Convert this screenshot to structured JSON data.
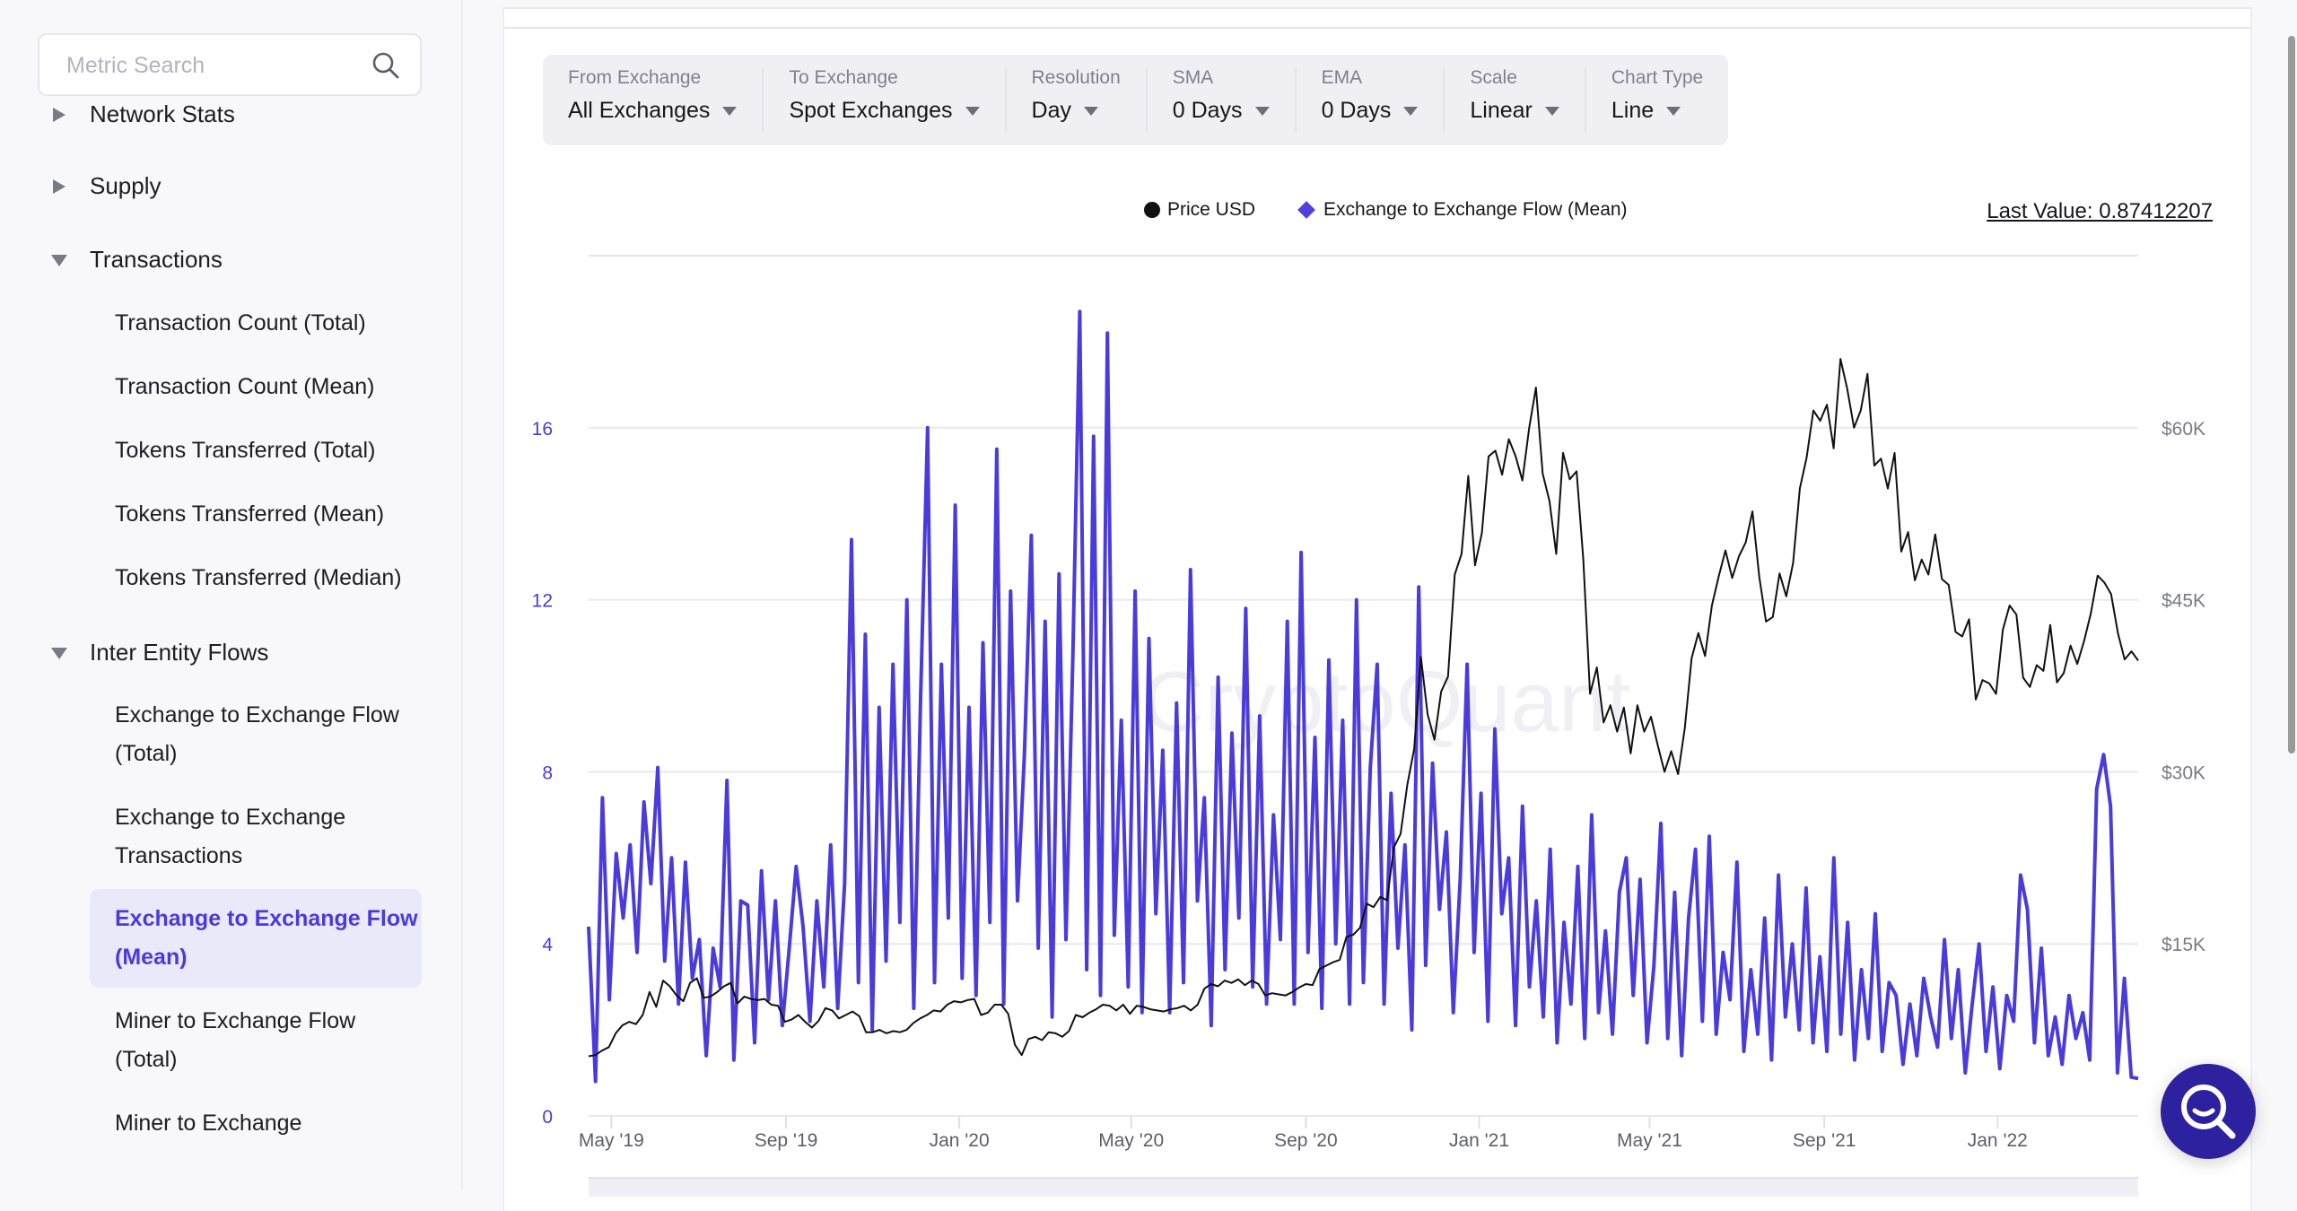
{
  "sidebar": {
    "search_placeholder": "Metric Search",
    "groups": [
      {
        "label": "Network Stats",
        "expanded": false
      },
      {
        "label": "Supply",
        "expanded": false
      },
      {
        "label": "Transactions",
        "expanded": true
      },
      {
        "label": "Inter Entity Flows",
        "expanded": true
      }
    ],
    "transactions_items": [
      "Transaction Count (Total)",
      "Transaction Count (Mean)",
      "Tokens Transferred (Total)",
      "Tokens Transferred (Mean)",
      "Tokens Transferred (Median)"
    ],
    "flows_items": [
      {
        "line1": "Exchange to Exchange Flow",
        "line2": "(Total)",
        "active": false
      },
      {
        "line1": "Exchange to Exchange",
        "line2": "Transactions",
        "active": false
      },
      {
        "line1": "Exchange to Exchange Flow",
        "line2": "(Mean)",
        "active": true
      },
      {
        "line1": "Miner to Exchange Flow",
        "line2": "(Total)",
        "active": false
      },
      {
        "line1": "Miner to Exchange",
        "line2": "",
        "active": false
      }
    ]
  },
  "toolbar": [
    {
      "label": "From Exchange",
      "value": "All Exchanges"
    },
    {
      "label": "To Exchange",
      "value": "Spot Exchanges"
    },
    {
      "label": "Resolution",
      "value": "Day"
    },
    {
      "label": "SMA",
      "value": "0 Days"
    },
    {
      "label": "EMA",
      "value": "0 Days"
    },
    {
      "label": "Scale",
      "value": "Linear"
    },
    {
      "label": "Chart Type",
      "value": "Line"
    }
  ],
  "legend": {
    "price": "Price USD",
    "flow": "Exchange to Exchange Flow (Mean)"
  },
  "last_value": "Last Value: 0.87412207",
  "watermark": "CryptoQuant",
  "colors": {
    "flow": "#4a3bdc",
    "price": "#111111",
    "accent": "#4a3bd9",
    "fab": "#2e21a0"
  },
  "chart_data": {
    "type": "line",
    "title": "",
    "x_tick_labels": [
      "May '19",
      "Sep '19",
      "Jan '20",
      "May '20",
      "Sep '20",
      "Jan '21",
      "May '21",
      "Sep '21",
      "Jan '22"
    ],
    "x_range": [
      "2019-04-15",
      "2022-04-10"
    ],
    "y_left": {
      "label": "Exchange to Exchange Flow (Mean)",
      "ticks": [
        0,
        4,
        8,
        12,
        16
      ],
      "range": [
        0,
        20
      ]
    },
    "y_right": {
      "label": "Price USD",
      "ticks": [
        "$15K",
        "$30K",
        "$45K",
        "$60K"
      ],
      "tick_values": [
        15000,
        30000,
        45000,
        60000
      ],
      "range": [
        0,
        75000
      ]
    },
    "grid": true,
    "legend_position": "top-center",
    "series": [
      {
        "name": "Exchange to Exchange Flow (Mean)",
        "axis": "left",
        "sampling": "approx every 6 days from 2019-04-15",
        "values": [
          4.4,
          0.8,
          7.4,
          2.7,
          6.1,
          4.6,
          6.3,
          3.8,
          7.3,
          5.4,
          8.1,
          3.6,
          6.0,
          2.6,
          5.9,
          3.2,
          4.1,
          1.4,
          3.9,
          3.0,
          7.8,
          1.3,
          5.0,
          4.9,
          1.7,
          5.7,
          2.7,
          5.0,
          2.1,
          3.9,
          5.8,
          4.4,
          2.2,
          5.0,
          3.0,
          6.3,
          2.5,
          5.4,
          13.4,
          3.1,
          11.2,
          2.0,
          9.5,
          3.6,
          10.5,
          4.5,
          12.0,
          2.5,
          9.8,
          16.0,
          3.1,
          10.5,
          4.6,
          14.2,
          3.2,
          9.5,
          2.8,
          11.0,
          4.5,
          15.5,
          2.6,
          12.2,
          5.0,
          8.4,
          13.5,
          3.9,
          11.5,
          2.3,
          12.6,
          4.1,
          10.7,
          18.7,
          3.4,
          15.8,
          2.8,
          18.2,
          4.2,
          9.2,
          3.0,
          12.2,
          2.4,
          11.1,
          4.7,
          8.5,
          2.4,
          9.6,
          3.1,
          12.7,
          5.0,
          7.4,
          2.1,
          10.2,
          3.4,
          8.9,
          4.6,
          11.8,
          3.0,
          9.3,
          2.6,
          7.0,
          4.1,
          11.5,
          2.6,
          13.1,
          3.8,
          8.8,
          2.5,
          10.6,
          4.0,
          9.2,
          2.6,
          12.0,
          3.1,
          8.1,
          10.5,
          2.6,
          7.5,
          3.9,
          6.3,
          2.0,
          12.3,
          3.5,
          8.2,
          4.8,
          6.6,
          2.4,
          5.5,
          10.5,
          3.8,
          7.5,
          2.2,
          9.0,
          4.7,
          6.0,
          2.1,
          7.2,
          3.0,
          5.0,
          2.3,
          6.2,
          1.7,
          4.5,
          2.6,
          5.8,
          1.8,
          7.0,
          2.4,
          4.3,
          1.9,
          5.2,
          6.0,
          2.8,
          5.5,
          1.7,
          3.5,
          6.8,
          1.8,
          5.2,
          1.4,
          4.6,
          6.2,
          2.2,
          6.5,
          1.9,
          3.8,
          2.7,
          5.9,
          1.5,
          3.4,
          1.9,
          4.6,
          1.3,
          5.6,
          2.3,
          4.0,
          2.0,
          5.3,
          1.7,
          3.7,
          1.5,
          6.0,
          1.9,
          4.5,
          1.3,
          3.4,
          1.8,
          4.7,
          1.5,
          3.1,
          2.8,
          1.2,
          2.6,
          1.4,
          3.2,
          2.3,
          1.6,
          4.1,
          1.8,
          3.4,
          1.0,
          2.6,
          4.0,
          1.5,
          3.0,
          1.1,
          2.8,
          2.2,
          5.6,
          4.8,
          1.7,
          3.9,
          1.4,
          2.3,
          1.2,
          2.8,
          1.8,
          2.4,
          1.3,
          7.6,
          8.4,
          7.2,
          1.0,
          3.2,
          0.9,
          0.87
        ]
      },
      {
        "name": "Price USD",
        "axis": "right",
        "sampling": "approx every 6 days from 2019-04-15",
        "values": [
          5200,
          5300,
          5700,
          6000,
          7200,
          7900,
          8200,
          8000,
          8800,
          10800,
          9500,
          11800,
          11300,
          10500,
          10000,
          11600,
          12000,
          10300,
          10400,
          10800,
          11300,
          11600,
          9800,
          10400,
          10200,
          10100,
          10200,
          9700,
          9600,
          8200,
          8400,
          8800,
          8200,
          7700,
          8300,
          9400,
          9200,
          8500,
          8800,
          9100,
          8700,
          7300,
          7300,
          7500,
          7200,
          7400,
          7300,
          7500,
          8100,
          8500,
          8800,
          9200,
          9100,
          9700,
          10000,
          9900,
          10100,
          10200,
          8800,
          9000,
          9700,
          9700,
          8900,
          6200,
          5300,
          6700,
          6900,
          6600,
          7300,
          7200,
          6900,
          7400,
          8800,
          8600,
          9000,
          9300,
          9700,
          9600,
          9200,
          9700,
          8900,
          9600,
          9500,
          9300,
          9200,
          9100,
          9300,
          9400,
          9600,
          9200,
          9700,
          11100,
          11500,
          11300,
          11800,
          11600,
          11900,
          11400,
          11800,
          11500,
          10500,
          10700,
          10600,
          10500,
          10800,
          11200,
          11500,
          11400,
          12800,
          13100,
          13400,
          13600,
          15600,
          15800,
          16400,
          18500,
          18200,
          19100,
          18800,
          23400,
          24600,
          28900,
          32000,
          40000,
          35000,
          32800,
          37000,
          38300,
          47200,
          49000,
          55800,
          48000,
          50800,
          57500,
          58000,
          55900,
          59000,
          57500,
          55400,
          60000,
          63500,
          56000,
          53600,
          49000,
          57800,
          55500,
          56200,
          48500,
          36800,
          39100,
          34300,
          35800,
          33500,
          35600,
          31600,
          35800,
          33500,
          34800,
          32300,
          30000,
          31800,
          29800,
          33800,
          39900,
          42100,
          40100,
          44500,
          47000,
          49300,
          46900,
          48800,
          50000,
          52700,
          47000,
          43100,
          43500,
          47300,
          45300,
          48200,
          54700,
          57400,
          61500,
          60600,
          62000,
          58200,
          66000,
          63400,
          60000,
          61500,
          64700,
          56700,
          57300,
          54700,
          57800,
          49200,
          50900,
          46700,
          48500,
          47200,
          50700,
          46800,
          46300,
          42200,
          41800,
          43300,
          36300,
          38000,
          37700,
          36800,
          42400,
          44500,
          43700,
          38200,
          37400,
          39300,
          38800,
          42800,
          37800,
          38600,
          41000,
          39400,
          41400,
          43800,
          47100,
          46500,
          45500,
          42100,
          39800,
          40500,
          39700
        ]
      }
    ]
  }
}
